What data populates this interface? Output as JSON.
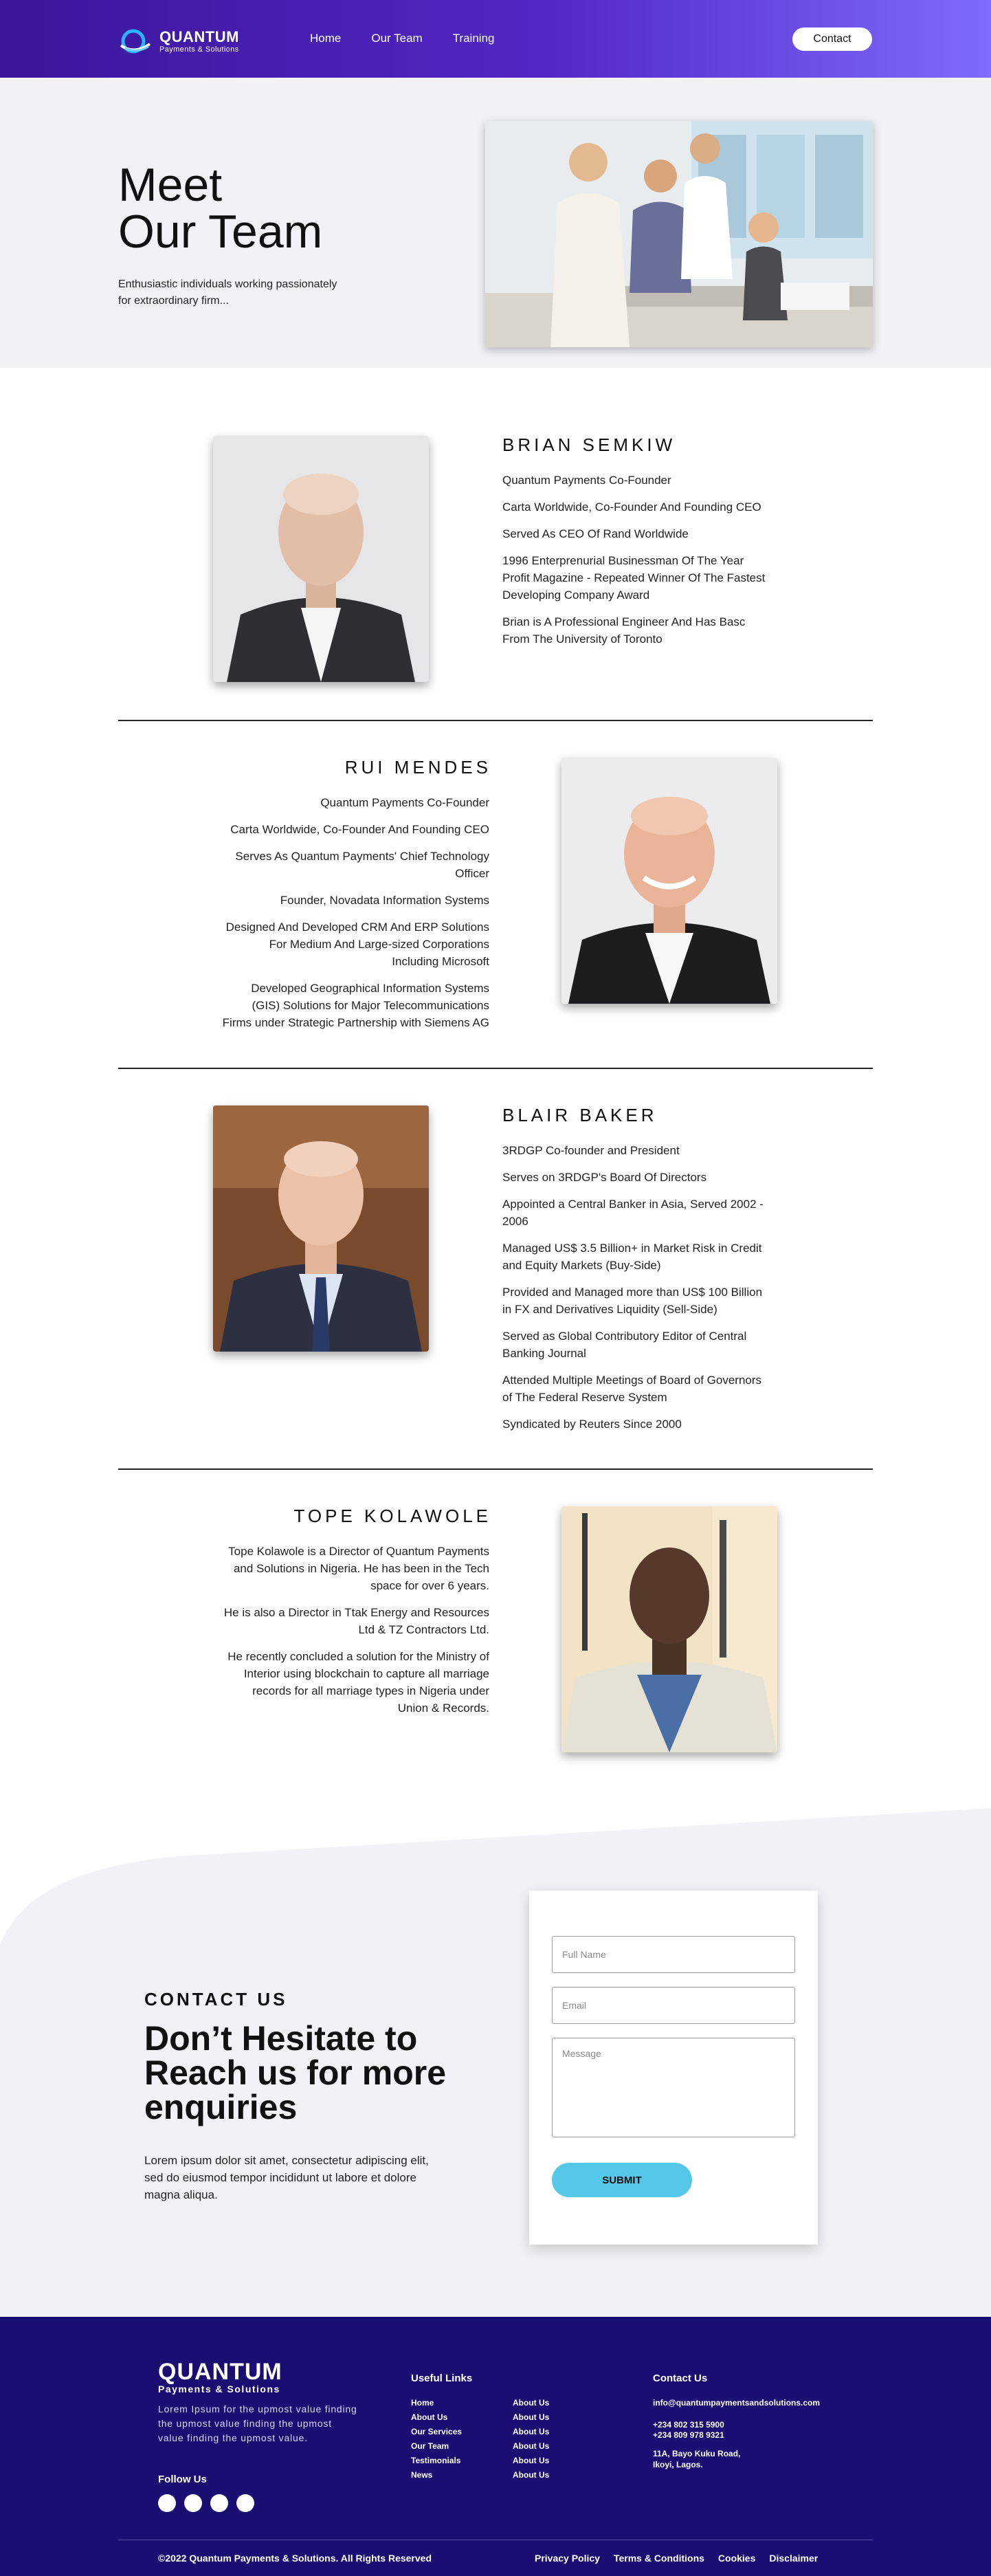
{
  "header": {
    "logo_title": "QUANTUM",
    "logo_subtitle": "Payments & Solutions",
    "nav": [
      "Home",
      "Our Team",
      "Training"
    ],
    "contact_button": "Contact"
  },
  "hero": {
    "title_line1": "Meet",
    "title_line2": "Our Team",
    "description": "Enthusiastic individuals working passionately for extraordinary firm..."
  },
  "team": [
    {
      "name": "BRIAN SEMKIW",
      "lines": [
        "Quantum Payments Co-Founder",
        "Carta Worldwide, Co-Founder And Founding CEO",
        "Served As CEO Of Rand Worldwide",
        "1996 Enterprenurial Businessman Of The Year Profit Magazine - Repeated Winner Of The Fastest Developing Company Award",
        "Brian is A Professional Engineer And Has Basc From The University of Toronto"
      ]
    },
    {
      "name": "RUI MENDES",
      "lines": [
        "Quantum Payments Co-Founder",
        "Carta Worldwide, Co-Founder And Founding CEO",
        "Serves As Quantum Payments' Chief Technology Officer",
        "Founder, Novadata Information Systems",
        "Designed And Developed CRM And ERP Solutions For Medium And Large-sized Corporations Including Microsoft",
        "Developed Geographical Information Systems (GIS) Solutions for Major Telecommunications Firms under Strategic Partnership with Siemens AG"
      ]
    },
    {
      "name": "BLAIR BAKER",
      "lines": [
        "3RDGP Co-founder and President",
        "Serves on 3RDGP's Board Of Directors",
        "Appointed a Central Banker in Asia, Served 2002 - 2006",
        "Managed US$ 3.5 Billion+ in Market Risk in Credit and Equity Markets (Buy-Side)",
        "Provided and Managed more than US$ 100 Billion in FX and Derivatives Liquidity (Sell-Side)",
        "Served as Global Contributory Editor of Central Banking Journal",
        "Attended Multiple Meetings of Board of Governors of The Federal Reserve System",
        "Syndicated by Reuters Since 2000"
      ]
    },
    {
      "name": "TOPE KOLAWOLE",
      "lines": [
        "Tope Kolawole is a Director of Quantum Payments and Solutions in Nigeria. He has been in the Tech space for over 6 years.",
        "He is also a Director in Ttak Energy and Resources Ltd & TZ Contractors Ltd.",
        "He recently concluded a solution for the Ministry of Interior using blockchain to capture all marriage records for all marriage types in Nigeria under Union & Records."
      ]
    }
  ],
  "contact": {
    "label": "CONTACT US",
    "title": "Don’t Hesitate to Reach us for more enquiries",
    "description": "Lorem ipsum dolor sit amet, consectetur adipiscing elit, sed do eiusmod tempor incididunt ut labore et dolore magna aliqua.",
    "form": {
      "name_placeholder": "Full Name",
      "email_placeholder": "Email",
      "message_placeholder": "Message",
      "submit": "SUBMIT"
    }
  },
  "footer": {
    "logo_title": "QUANTUM",
    "logo_subtitle": "Payments & Solutions",
    "about": "Lorem Ipsum for the upmost value finding the upmost value finding the upmost value finding the upmost value.",
    "follow": "Follow Us",
    "useful_links_heading": "Useful Links",
    "links_col1": [
      "Home",
      "About Us",
      "Our Services",
      "Our Team",
      "Testimonials",
      "News"
    ],
    "links_col2": [
      "About Us",
      "About Us",
      "About Us",
      "About Us",
      "About Us",
      "About Us"
    ],
    "contact_heading": "Contact Us",
    "email": "info@quantumpaymentsandsolutions.com",
    "phone1": "+234 802 315 5900",
    "phone2": "+234 809 978 9321",
    "address1": "11A, Bayo Kuku Road,",
    "address2": "Ikoyi, Lagos.",
    "copyright": "©2022 Quantum Payments & Solutions. All Rights Reserved",
    "legal": [
      "Privacy Policy",
      "Terms & Conditions",
      "Cookies",
      "Disclaimer"
    ]
  },
  "colors": {
    "header_start": "#3a1699",
    "header_end": "#7f6bff",
    "footer_bg": "#1a0e73",
    "submit_bg": "#55c8ea",
    "section_bg": "#f2f1f5"
  }
}
